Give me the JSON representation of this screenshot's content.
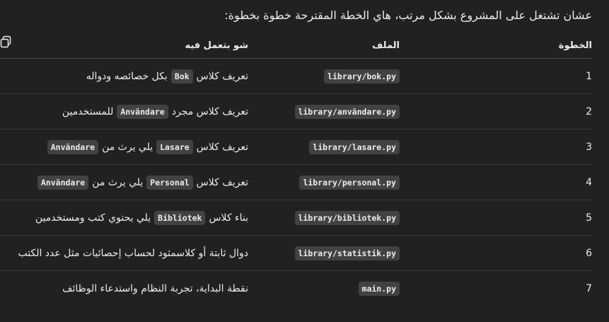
{
  "intro": "عشان تشتغل على المشروع بشكل مرتب، هاي الخطة المقترحة خطوة بخطوة:",
  "headers": {
    "step": "الخطوة",
    "file": "الملف",
    "desc": "شو بتعمل فيه"
  },
  "rows": [
    {
      "step": "1",
      "file": "library/bok.py",
      "desc_pre": "تعريف كلاس",
      "code": "Bok",
      "desc_post": "بكل خصائصه ودواله",
      "code2": ""
    },
    {
      "step": "2",
      "file": "library/användare.py",
      "desc_pre": "تعريف كلاس مجرد",
      "code": "Användare",
      "desc_post": "للمستخدمين",
      "code2": ""
    },
    {
      "step": "3",
      "file": "library/lasare.py",
      "desc_pre": "تعريف كلاس",
      "code": "Lasare",
      "desc_post": "يلي يرث من",
      "code2": "Användare"
    },
    {
      "step": "4",
      "file": "library/personal.py",
      "desc_pre": "تعريف كلاس",
      "code": "Personal",
      "desc_post": "يلي يرث من",
      "code2": "Användare"
    },
    {
      "step": "5",
      "file": "library/bibliotek.py",
      "desc_pre": "بناء كلاس",
      "code": "Bibliotek",
      "desc_post": "يلي يحتوي كتب ومستخدمين",
      "code2": ""
    },
    {
      "step": "6",
      "file": "library/statistik.py",
      "desc_pre": "دوال ثابتة أو كلاسمثود لحساب إحصائيات مثل عدد الكتب",
      "code": "",
      "desc_post": "",
      "code2": ""
    },
    {
      "step": "7",
      "file": "main.py",
      "desc_pre": "نقطة البداية، تجربة النظام واستدعاء الوظائف",
      "code": "",
      "desc_post": "",
      "code2": ""
    }
  ],
  "icons": {
    "copy": "copy-icon"
  }
}
